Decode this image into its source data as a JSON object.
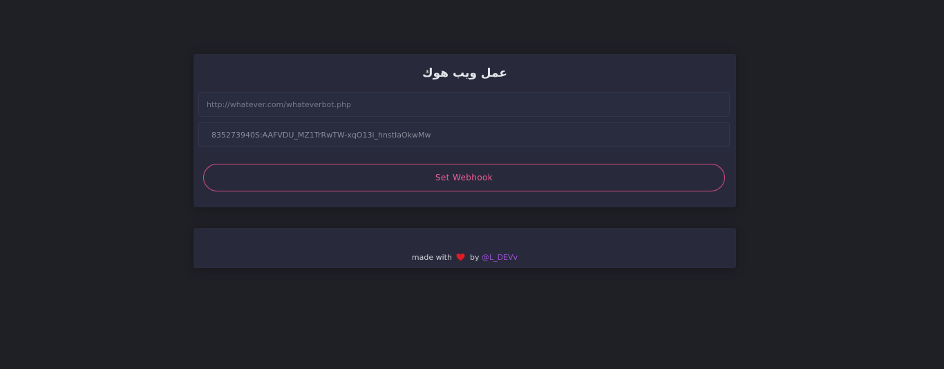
{
  "form": {
    "title": "عمل ويب هوك",
    "url_input": {
      "value": "",
      "placeholder": "http://whatever.com/whateverbot.php"
    },
    "token_input": {
      "value": "835273940S:AAFVDU_MZ1TrRwTW-xqO13i_hnstIaOkwMw",
      "placeholder": ""
    },
    "submit_label": "Set Webhook"
  },
  "footer": {
    "prefix": "made with",
    "heart_icon": "heart-icon",
    "by": "by",
    "author": "@L_DEVv"
  },
  "colors": {
    "background": "#1f1f26",
    "card": "#282a3c",
    "button_accent": "#ee5d95",
    "link": "#9b52d4",
    "heart": "#e01b24"
  }
}
